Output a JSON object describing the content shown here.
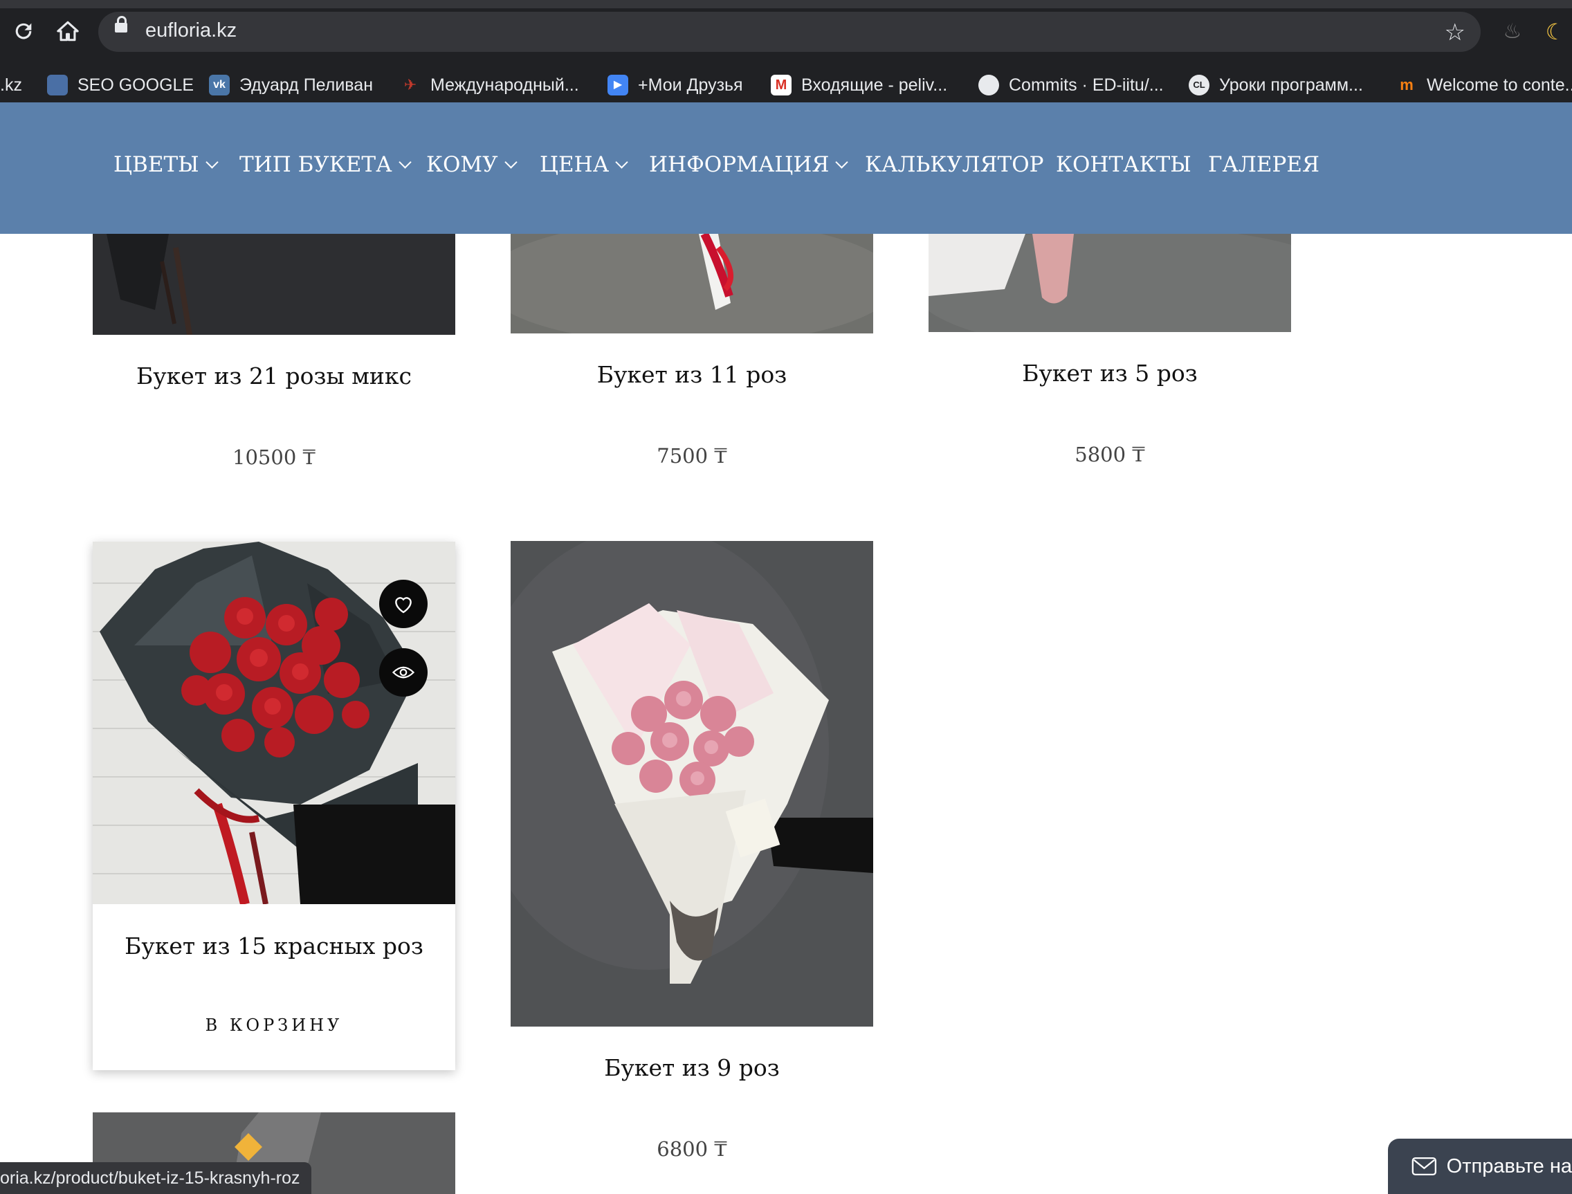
{
  "browser": {
    "url": "eufloria.kz",
    "bookmarks": [
      ".kz",
      "SEO GOOGLE",
      "Эдуард Пеливан",
      "Международный...",
      "+Мои Друзья",
      "Входящие - peliv...",
      "Commits · ED-iitu/...",
      "Уроки программ...",
      "Welcome to conte..."
    ],
    "status_url": "oria.kz/product/buket-iz-15-krasnyh-roz"
  },
  "nav": {
    "items": [
      "ЦВЕТЫ",
      "ТИП БУКЕТА",
      "КОМУ",
      "ЦЕНА",
      "ИНФОРМАЦИЯ",
      "КАЛЬКУЛЯТОР",
      "КОНТАКТЫ",
      "ГАЛЕРЕЯ"
    ]
  },
  "products": [
    {
      "title": "Букет из 21 розы микс",
      "price": "10500 ₸"
    },
    {
      "title": "Букет из 11 роз",
      "price": "7500 ₸"
    },
    {
      "title": "Букет из 5 роз",
      "price": "5800 ₸"
    },
    {
      "title": "Букет из 15 красных роз",
      "cart_label": "В КОРЗИНУ"
    },
    {
      "title": "Букет из 9 роз",
      "price": "6800 ₸"
    }
  ],
  "chat": {
    "label": "Отправьте на"
  },
  "colors": {
    "nav_bg": "#5b80ab",
    "browser_bg": "#202124"
  }
}
